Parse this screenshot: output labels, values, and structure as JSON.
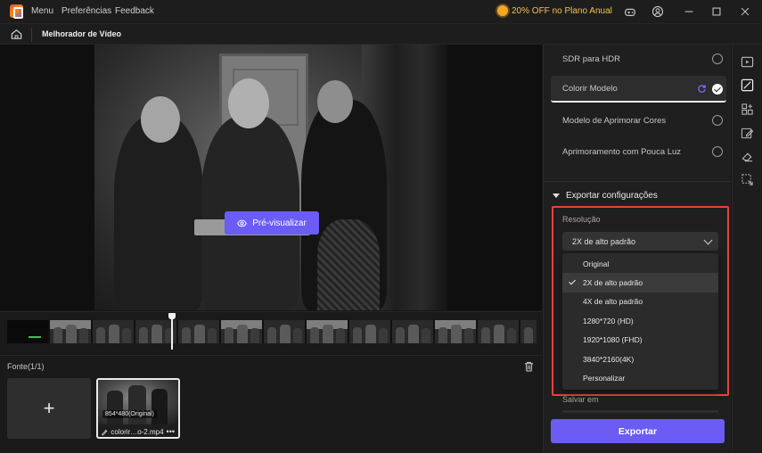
{
  "titlebar": {
    "menu_label": "Menu",
    "preferences_label": "Preferências",
    "feedback_label": "Feedback",
    "promo_text": "20% OFF no Plano Anual"
  },
  "navbar": {
    "title": "Melhorador de Vídeo"
  },
  "preview": {
    "button_label": "Pré-visualizar"
  },
  "source": {
    "title": "Fonte(1/1)",
    "add_symbol": "+",
    "file": {
      "resolution_badge": "854*480(Original)",
      "name": "colorir…o-2.mp4",
      "more_symbol": "•••"
    }
  },
  "models": [
    {
      "label": "SDR para HDR",
      "selected": false
    },
    {
      "label": "Colorir Modelo",
      "selected": true
    },
    {
      "label": "Modelo de Aprimorar Cores",
      "selected": false
    },
    {
      "label": "Aprimoramento com Pouca Luz",
      "selected": false
    }
  ],
  "export": {
    "section_title": "Exportar configurações",
    "resolution_label": "Resolução",
    "resolution_selected": "2X de alto padrão",
    "resolution_options": [
      "Original",
      "2X de alto padrão",
      "4X de alto padrão",
      "1280*720 (HD)",
      "1920*1080 (FHD)",
      "3840*2160(4K)",
      "Personalizar"
    ],
    "save_label": "Salvar em",
    "export_button": "Exportar"
  },
  "colors": {
    "accent": "#6b5cf5",
    "highlight_border": "#e3453a",
    "promo": "#f2c14a"
  }
}
